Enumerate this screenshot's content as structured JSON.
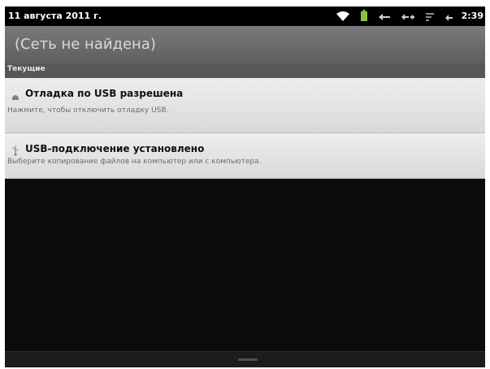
{
  "status_bar": {
    "date": "11 августа 2011 г.",
    "time": "2:39",
    "icons": [
      "wifi-icon",
      "battery-icon",
      "back-icon",
      "volume-icon",
      "menu-icon",
      "home-icon"
    ]
  },
  "header": {
    "title": "(Сеть не найдена)"
  },
  "section": {
    "label": "Текущие"
  },
  "notifications": [
    {
      "icon": "android-icon",
      "title": "Отладка по USB разрешена",
      "text": "Нажмите, чтобы отключить отладку USB."
    },
    {
      "icon": "usb-icon",
      "title": "USB-подключение установлено",
      "text": "Выберите копирование файлов на компьютер или с компьютера."
    }
  ],
  "colors": {
    "wifi": "#ffffff",
    "battery": "#8bc53f",
    "panel": "#e6e6e6",
    "background": "#0b0b0b"
  }
}
